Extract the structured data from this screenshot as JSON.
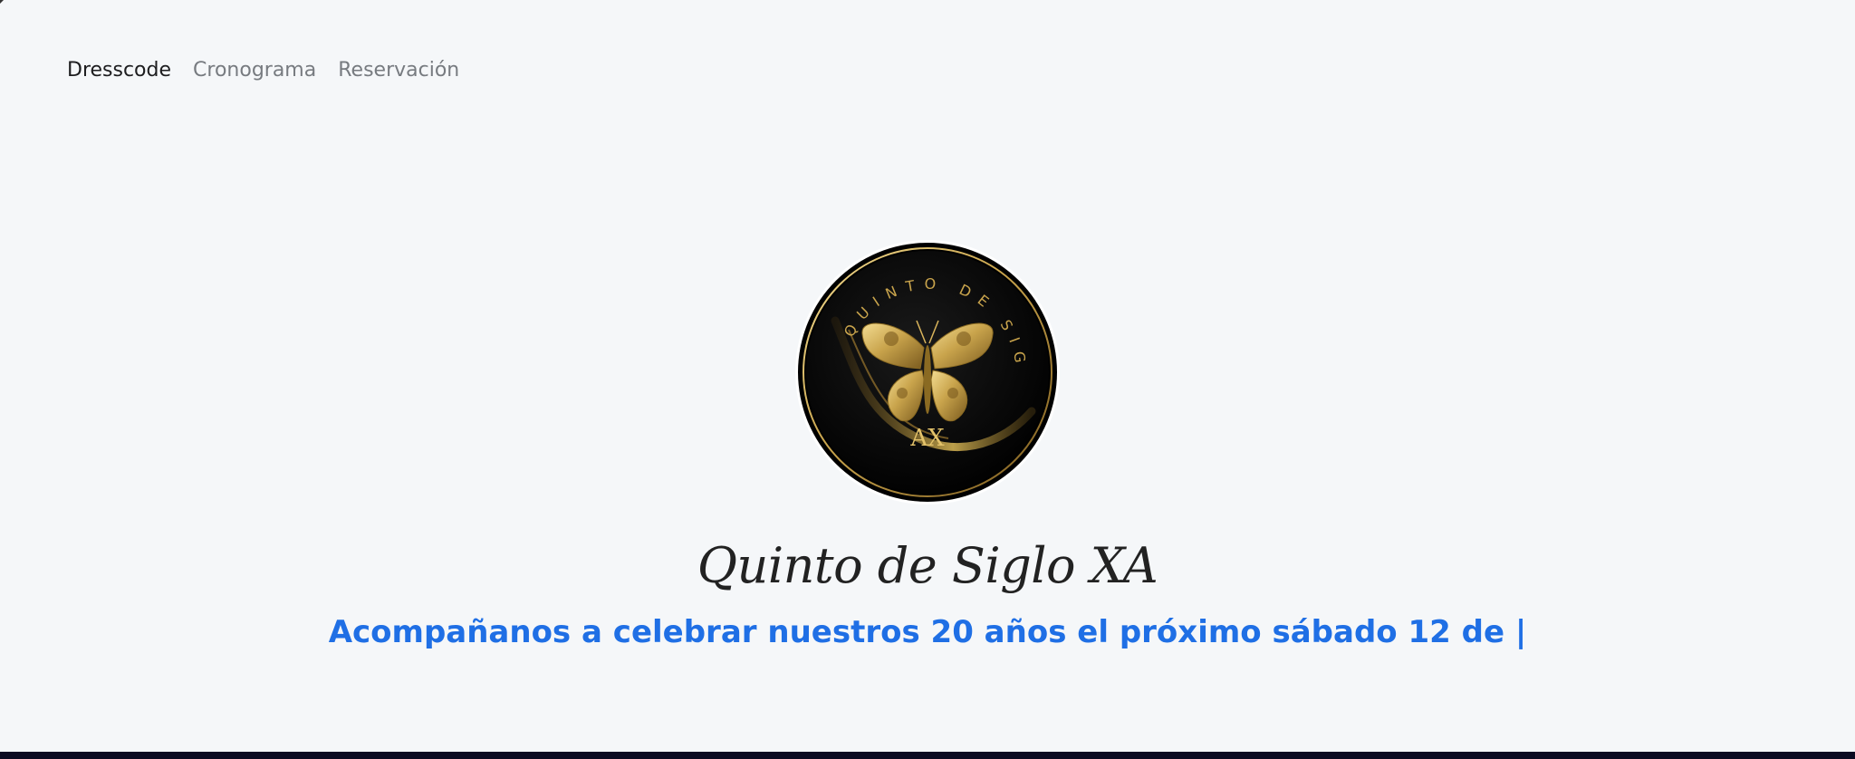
{
  "nav": {
    "items": [
      {
        "label": "Dresscode",
        "active": true
      },
      {
        "label": "Cronograma",
        "active": false
      },
      {
        "label": "Reservación",
        "active": false
      }
    ]
  },
  "logo": {
    "ring_text": "QUINTO DE SIGLO",
    "monogram": "AX",
    "icon": "butterfly-icon"
  },
  "hero": {
    "title": "Quinto de Siglo XA",
    "subtitle": "Acompañanos a celebrar nuestros 20 años el próximo sábado 12 de |"
  },
  "colors": {
    "background": "#f5f7f9",
    "accent": "#1f6fe5",
    "gold": "#c9a44c",
    "footer": "#0b0b22"
  }
}
